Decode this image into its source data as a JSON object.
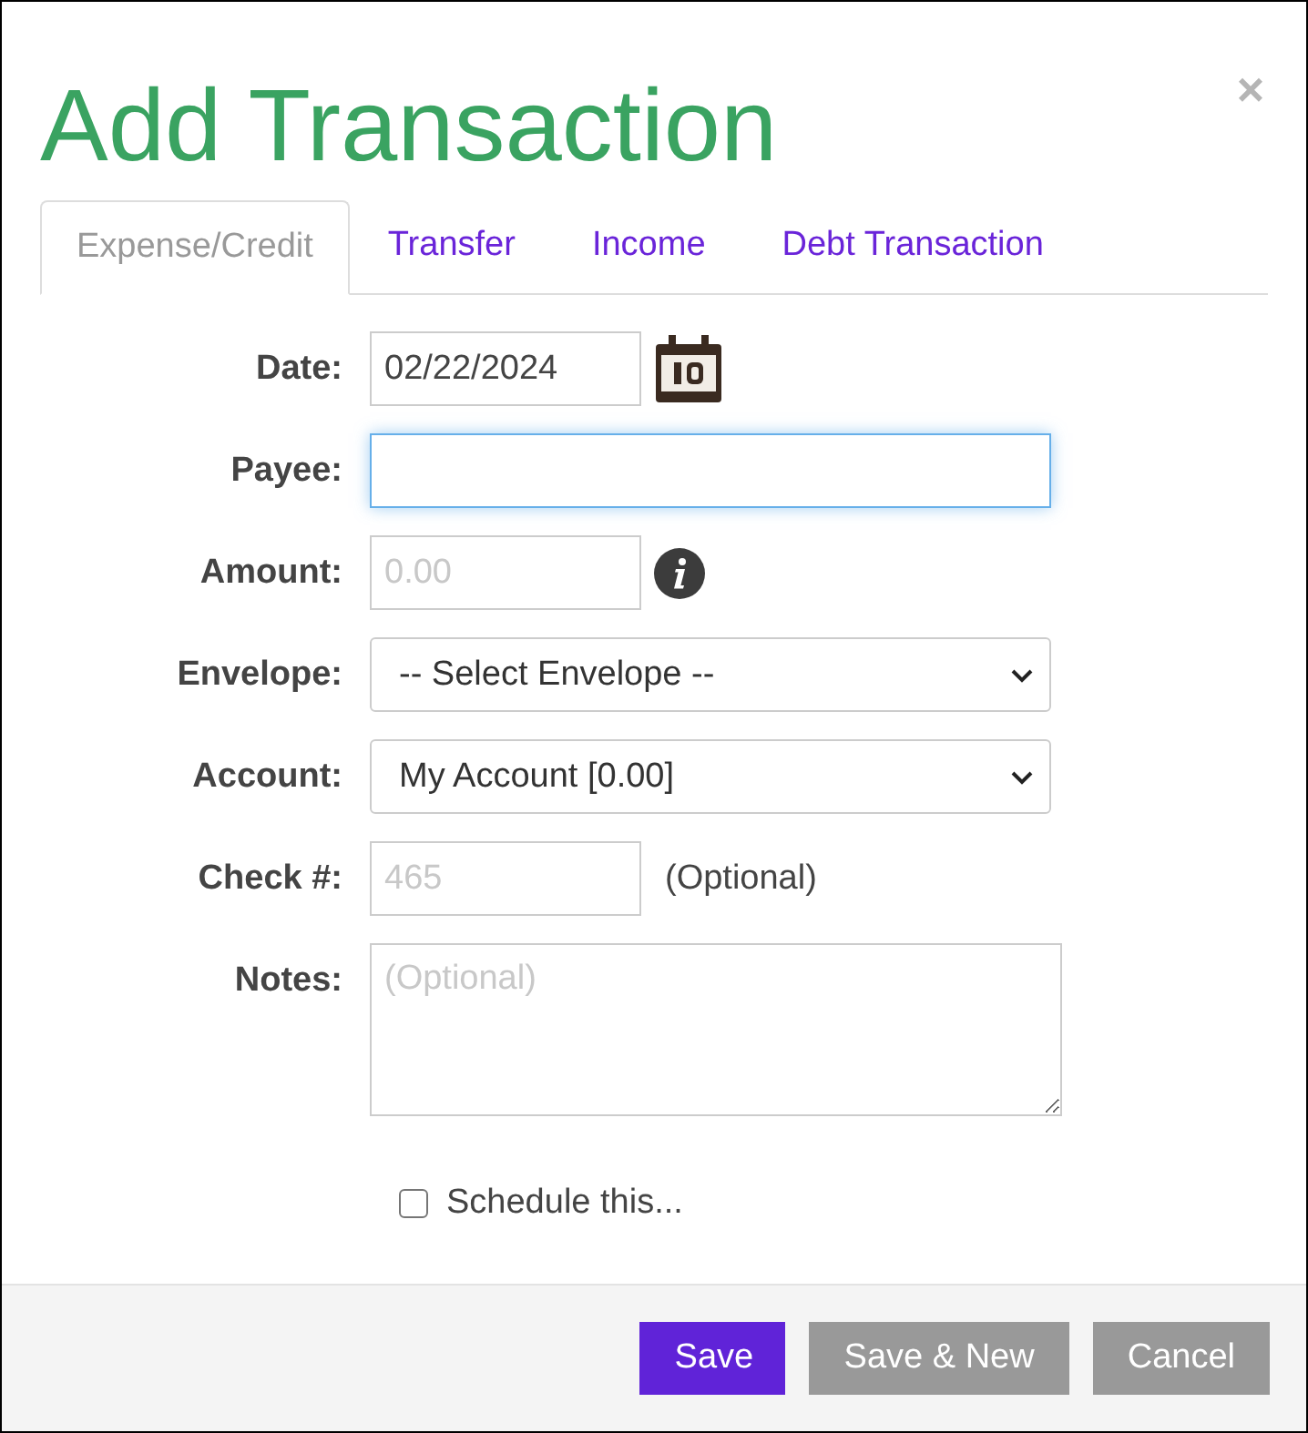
{
  "dialog": {
    "title": "Add Transaction",
    "close": "×"
  },
  "tabs": [
    {
      "label": "Expense/Credit",
      "selected": true
    },
    {
      "label": "Transfer",
      "selected": false
    },
    {
      "label": "Income",
      "selected": false
    },
    {
      "label": "Debt Transaction",
      "selected": false
    }
  ],
  "fields": [
    {
      "label": "Date:",
      "kind": "date",
      "value": "02/22/2024",
      "focused": false
    },
    {
      "label": "Payee:",
      "kind": "text",
      "focused": true
    },
    {
      "label": "Amount:",
      "kind": "amount",
      "placeholder": "0.00",
      "focused": false
    },
    {
      "label": "Envelope:",
      "kind": "select",
      "value": "-- Select Envelope --",
      "focused": false
    },
    {
      "label": "Account:",
      "kind": "select",
      "value": "My Account [0.00]",
      "focused": false
    },
    {
      "label": "Check #:",
      "kind": "check",
      "placeholder": "465",
      "hint": "(Optional)",
      "focused": false
    },
    {
      "label": "Notes:",
      "kind": "textarea",
      "placeholder": "(Optional)",
      "focused": false
    }
  ],
  "schedule": {
    "label": "Schedule this...",
    "checked": false
  },
  "buttons": [
    {
      "label": "Save",
      "kind": "primary"
    },
    {
      "label": "Save & New",
      "kind": "secondary"
    },
    {
      "label": "Cancel",
      "kind": "secondary"
    }
  ]
}
